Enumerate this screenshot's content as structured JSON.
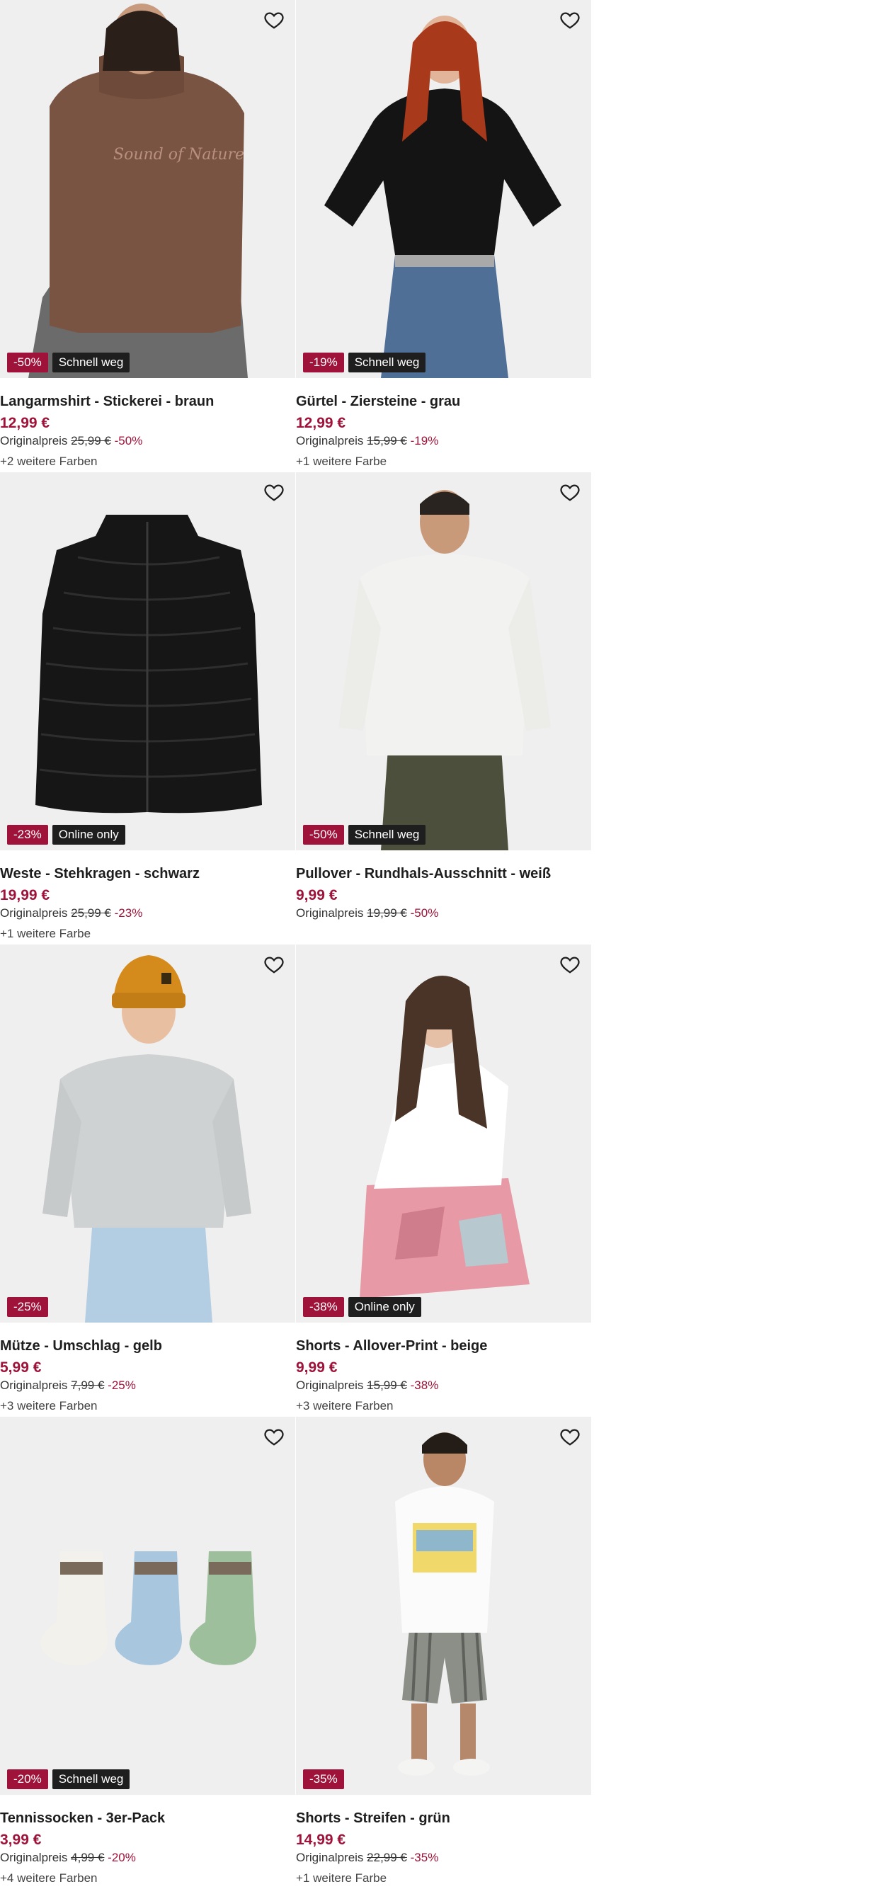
{
  "products": [
    {
      "name": "Langarmshirt - Stickerei - braun",
      "price": "12,99 €",
      "original_label": "Originalpreis",
      "original_price": "25,99 €",
      "discount": "-50%",
      "badge_discount": "-50%",
      "badge_tag": "Schnell weg",
      "more_colors": "+2 weitere Farben",
      "image_icon": "woman-brown-sweater-image"
    },
    {
      "name": "Gürtel - Ziersteine - grau",
      "price": "12,99 €",
      "original_label": "Originalpreis",
      "original_price": "15,99 €",
      "discount": "-19%",
      "badge_discount": "-19%",
      "badge_tag": "Schnell weg",
      "more_colors": "+1 weitere Farbe",
      "image_icon": "woman-black-top-jeans-image"
    },
    {
      "name": "Weste - Stehkragen - schwarz",
      "price": "19,99 €",
      "original_label": "Originalpreis",
      "original_price": "25,99 €",
      "discount": "-23%",
      "badge_discount": "-23%",
      "badge_tag": "Online only",
      "more_colors": "+1 weitere Farbe",
      "image_icon": "black-puffer-vest-image"
    },
    {
      "name": "Pullover - Rundhals-Ausschnitt - weiß",
      "price": "9,99 €",
      "original_label": "Originalpreis",
      "original_price": "19,99 €",
      "discount": "-50%",
      "badge_discount": "-50%",
      "badge_tag": "Schnell weg",
      "more_colors": "",
      "image_icon": "man-white-pullover-image"
    },
    {
      "name": "Mütze - Umschlag - gelb",
      "price": "5,99 €",
      "original_label": "Originalpreis",
      "original_price": "7,99 €",
      "discount": "-25%",
      "badge_discount": "-25%",
      "badge_tag": "",
      "more_colors": "+3 weitere Farben",
      "image_icon": "man-yellow-beanie-image"
    },
    {
      "name": "Shorts - Allover-Print - beige",
      "price": "9,99 €",
      "original_label": "Originalpreis",
      "original_price": "15,99 €",
      "discount": "-38%",
      "badge_discount": "-38%",
      "badge_tag": "Online only",
      "more_colors": "+3 weitere Farben",
      "image_icon": "woman-print-shorts-image"
    },
    {
      "name": "Tennissocken - 3er-Pack",
      "price": "3,99 €",
      "original_label": "Originalpreis",
      "original_price": "4,99 €",
      "discount": "-20%",
      "badge_discount": "-20%",
      "badge_tag": "Schnell weg",
      "more_colors": "+4 weitere Farben",
      "image_icon": "tennis-socks-image"
    },
    {
      "name": "Shorts - Streifen - grün",
      "price": "14,99 €",
      "original_label": "Originalpreis",
      "original_price": "22,99 €",
      "discount": "-35%",
      "badge_discount": "-35%",
      "badge_tag": "",
      "more_colors": "+1 weitere Farbe",
      "image_icon": "man-striped-shorts-image"
    }
  ],
  "colors": {
    "discount": "#9f1239",
    "tag_bg": "#1e1e1e",
    "image_bg": "#efefef"
  }
}
